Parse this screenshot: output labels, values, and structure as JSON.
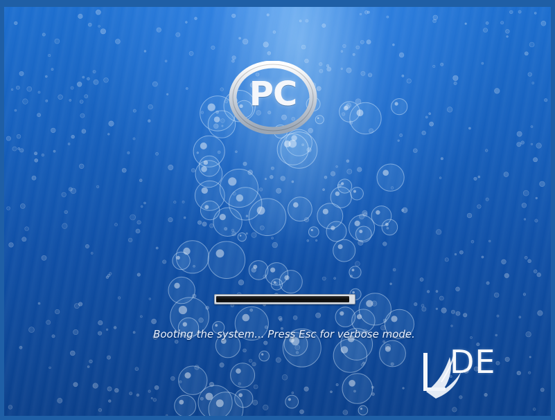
{
  "splash": {
    "logo_text": "PC",
    "status_text": "Booting the system... Press Esc for verbose mode.",
    "progress_fraction": 0.97
  },
  "brand": {
    "text": "DE",
    "mark_letter": "L"
  },
  "colors": {
    "background": "#1660bd",
    "accent": "#f5f7fb",
    "progress_fill": "#0b0b0b"
  },
  "icons": {
    "logo": "pc-circle-logo",
    "brand": "lxde-logo"
  }
}
